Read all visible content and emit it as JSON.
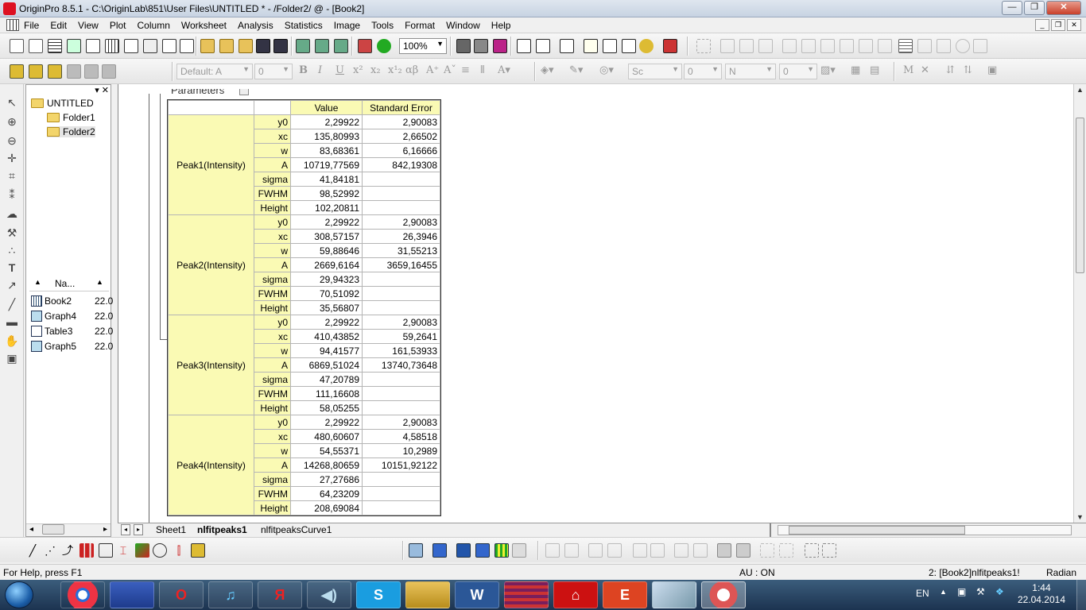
{
  "window": {
    "title": "OriginPro 8.5.1 - C:\\OriginLab\\851\\User Files\\UNTITLED * - /Folder2/ @ - [Book2]",
    "minimize_label": "—",
    "maximize_label": "❐",
    "close_label": "✕"
  },
  "menubar": {
    "items": [
      "File",
      "Edit",
      "View",
      "Plot",
      "Column",
      "Worksheet",
      "Analysis",
      "Statistics",
      "Image",
      "Tools",
      "Format",
      "Window",
      "Help"
    ]
  },
  "toolbar": {
    "zoom": "100%",
    "font_name": "Default: A",
    "font_size": "0",
    "line_style": "Sc",
    "line_width": "0",
    "fill_label": "N",
    "pattern_width": "0"
  },
  "explorer": {
    "root": "UNTITLED",
    "folders": [
      "Folder1",
      "Folder2"
    ],
    "list_header": "Na...",
    "windows": [
      {
        "name": "Book2",
        "date": "22.0"
      },
      {
        "name": "Graph4",
        "date": "22.0"
      },
      {
        "name": "Table3",
        "date": "22.0"
      },
      {
        "name": "Graph5",
        "date": "22.0"
      }
    ]
  },
  "report": {
    "section_label": "Parameters",
    "headers": [
      "Value",
      "Standard Error"
    ],
    "peaks": [
      {
        "name": "Peak1(Intensity)",
        "rows": [
          {
            "param": "y0",
            "value": "2,29922",
            "error": "2,90083"
          },
          {
            "param": "xc",
            "value": "135,80993",
            "error": "2,66502"
          },
          {
            "param": "w",
            "value": "83,68361",
            "error": "6,16666"
          },
          {
            "param": "A",
            "value": "10719,77569",
            "error": "842,19308"
          },
          {
            "param": "sigma",
            "value": "41,84181",
            "error": ""
          },
          {
            "param": "FWHM",
            "value": "98,52992",
            "error": ""
          },
          {
            "param": "Height",
            "value": "102,20811",
            "error": ""
          }
        ]
      },
      {
        "name": "Peak2(Intensity)",
        "rows": [
          {
            "param": "y0",
            "value": "2,29922",
            "error": "2,90083"
          },
          {
            "param": "xc",
            "value": "308,57157",
            "error": "26,3946"
          },
          {
            "param": "w",
            "value": "59,88646",
            "error": "31,55213"
          },
          {
            "param": "A",
            "value": "2669,6164",
            "error": "3659,16455"
          },
          {
            "param": "sigma",
            "value": "29,94323",
            "error": ""
          },
          {
            "param": "FWHM",
            "value": "70,51092",
            "error": ""
          },
          {
            "param": "Height",
            "value": "35,56807",
            "error": ""
          }
        ]
      },
      {
        "name": "Peak3(Intensity)",
        "rows": [
          {
            "param": "y0",
            "value": "2,29922",
            "error": "2,90083"
          },
          {
            "param": "xc",
            "value": "410,43852",
            "error": "59,2641"
          },
          {
            "param": "w",
            "value": "94,41577",
            "error": "161,53933"
          },
          {
            "param": "A",
            "value": "6869,51024",
            "error": "13740,73648"
          },
          {
            "param": "sigma",
            "value": "47,20789",
            "error": ""
          },
          {
            "param": "FWHM",
            "value": "111,16608",
            "error": ""
          },
          {
            "param": "Height",
            "value": "58,05255",
            "error": ""
          }
        ]
      },
      {
        "name": "Peak4(Intensity)",
        "rows": [
          {
            "param": "y0",
            "value": "2,29922",
            "error": "2,90083"
          },
          {
            "param": "xc",
            "value": "480,60607",
            "error": "4,58518"
          },
          {
            "param": "w",
            "value": "54,55371",
            "error": "10,2989"
          },
          {
            "param": "A",
            "value": "14268,80659",
            "error": "10151,92122"
          },
          {
            "param": "sigma",
            "value": "27,27686",
            "error": ""
          },
          {
            "param": "FWHM",
            "value": "64,23209",
            "error": ""
          },
          {
            "param": "Height",
            "value": "208,69084",
            "error": ""
          }
        ]
      }
    ]
  },
  "sheets": {
    "tabs": [
      "Sheet1",
      "nlfitpeaks1",
      "nlfitpeaksCurve1"
    ],
    "active": "nlfitpeaks1"
  },
  "statusbar": {
    "help": "For Help, press F1",
    "au": "AU : ON",
    "active_window": "2: [Book2]nlfitpeaks1!",
    "angle_unit": "Radian"
  },
  "taskbar": {
    "language": "EN",
    "time": "1:44",
    "date": "22.04.2014"
  },
  "colors": {
    "header_fill": "#fafab4",
    "title_bar": "#c7d3e2",
    "taskbar": "#1c3350"
  }
}
